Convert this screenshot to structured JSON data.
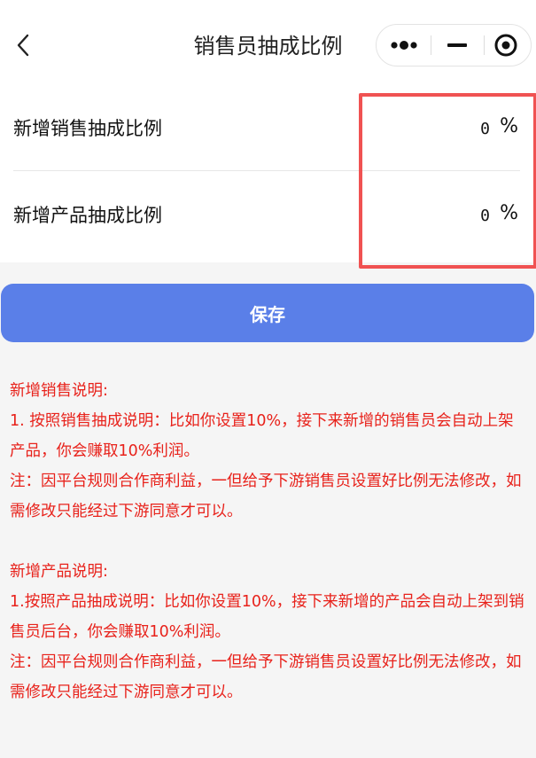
{
  "navbar": {
    "title": "销售员抽成比例",
    "back_icon": "chevron-left-icon",
    "capsule_icons": [
      "more-dots-icon",
      "minimize-icon",
      "close-target-icon"
    ]
  },
  "form": {
    "rows": [
      {
        "label": "新增销售抽成比例",
        "value": "0",
        "unit": "%"
      },
      {
        "label": "新增产品抽成比例",
        "value": "0",
        "unit": "%"
      }
    ]
  },
  "save_label": "保存",
  "notes": {
    "sales": {
      "title": "新增销售说明:",
      "lines": [
        "1. 按照销售抽成说明：比如你设置10%，接下来新增的销售员会自动上架产品，你会赚取10%利润。",
        "注：因平台规则合作商利益，一但给予下游销售员设置好比例无法修改，如需修改只能经过下游同意才可以。"
      ]
    },
    "product": {
      "title": "新增产品说明:",
      "lines": [
        "1.按照产品抽成说明：比如你设置10%，接下来新增的产品会自动上架到销售员后台，你会赚取10%利润。",
        "注：因平台规则合作商利益，一但给予下游销售员设置好比例无法修改，如需修改只能经过下游同意才可以。"
      ]
    }
  },
  "colors": {
    "accent": "#5a7fe8",
    "note_text": "#e8221b",
    "highlight_border": "#f05252"
  }
}
